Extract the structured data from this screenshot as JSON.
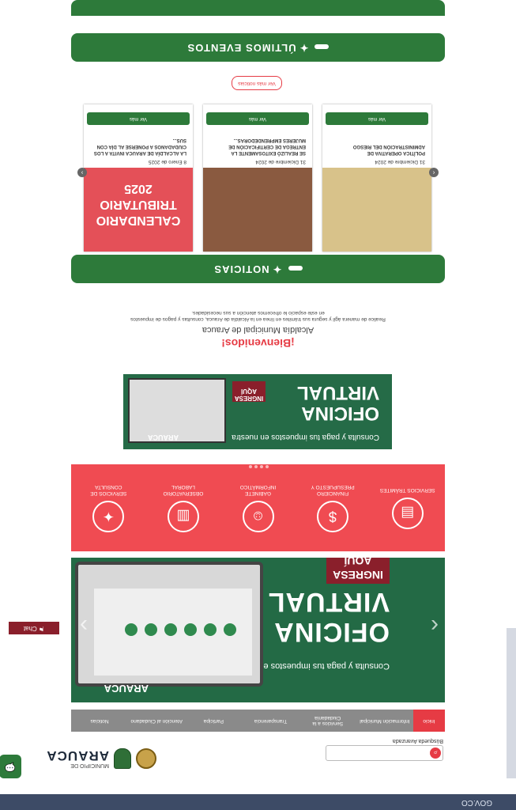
{
  "topbar": {
    "label": "GOV.CO"
  },
  "header": {
    "logo_small": "MUNICIPIO DE",
    "logo_name": "ARAUCA",
    "search_placeholder": "",
    "advanced_search": "Búsqueda Avanzada"
  },
  "nav": {
    "items": [
      "Inicio",
      "Información Municipal",
      "Servicios a la Ciudadanía",
      "Transparencia",
      "Participa",
      "Atención al Ciudadano",
      "Noticias"
    ]
  },
  "hero": {
    "line1": "Consulta y paga tus impuestos en nuestra",
    "line2": "OFICINA",
    "line3": "VIRTUAL",
    "cta": "INGRESA AQUÍ",
    "brand": "ARAUCA"
  },
  "services": [
    {
      "label": "SERVICIOS TRÁMITES",
      "icon": "document-icon"
    },
    {
      "label": "FINANCIERO PRESUPUESTO Y",
      "icon": "finance-icon"
    },
    {
      "label": "GABINETE INFORMÁTICO",
      "icon": "team-icon"
    },
    {
      "label": "OBSERVATORIO LABORAL",
      "icon": "chart-icon"
    },
    {
      "label": "SERVICIOS DE CONSULTA",
      "icon": "lightbulb-icon"
    },
    {
      "label": "TRÁMITES",
      "icon": "form-icon"
    }
  ],
  "banner": {
    "line1": "Consulta y paga tus impuestos en nuestra",
    "line2": "OFICINA",
    "line3": "VIRTUAL",
    "cta": "INGRESA AQUÍ",
    "brand": "ARAUCA"
  },
  "welcome": {
    "heading": "¡Bienvenidos!",
    "subheading": "Alcaldía Municipal de Arauca",
    "paragraph1": "Realice de manera ágil y segura sus trámites en línea en la Alcaldía de Arauca, consultas y pagos de impuestos",
    "paragraph2": "en este espacio le ofrecemos atención a sus necesidades."
  },
  "news_section": {
    "title": "NOTICIAS"
  },
  "news": [
    {
      "date": "31 Diciembre de 2024",
      "title": "POLÍTICA OPERATIVA DE ADMINISTRACIÓN DEL RIESGO",
      "button": "Ver más",
      "img_color": "#d8c28a"
    },
    {
      "date": "31 Diciembre de 2024",
      "title": "SE REALIZÓ EXITOSAMENTE LA ENTREGA DE CERTIFICACIÓN DE MUJERES EMPRENDEDORAS...",
      "button": "Ver más",
      "img_color": "#8a5a40"
    },
    {
      "date": "8 Enero de 2025",
      "title": "LA ALCALDÍA DE ARAUCA INVITA A LOS CIUDADANOS A PONERSE AL DÍA CON SUS...",
      "button": "Ver más",
      "img_color": "#e45058"
    }
  ],
  "news_more": "Ver más noticias",
  "events_section": {
    "title": "ÚLTIMOS EVENTOS"
  },
  "calendar_card": {
    "title": "CALENDARIO TRIBUTARIO",
    "year": "2025"
  },
  "fab_left": "💬",
  "fab_right": "⚑ Chat"
}
